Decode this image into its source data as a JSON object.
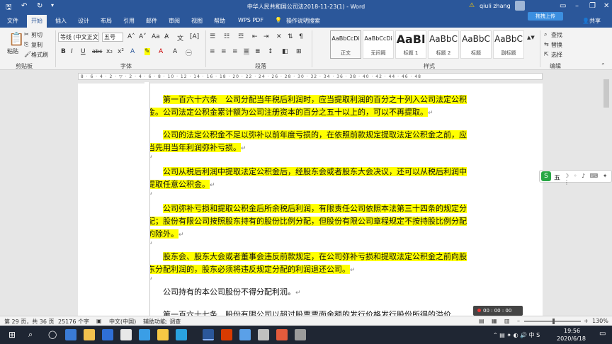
{
  "titlebar": {
    "title": "中华人民共和国公司法2018-11-23(1)  -  Word",
    "user": "qiuli zhang",
    "upload_button": "拖拽上传",
    "save_icon": "save-icon",
    "undo_icon": "undo-icon",
    "redo_icon": "redo-icon"
  },
  "tabs": [
    "文件",
    "开始",
    "插入",
    "设计",
    "布局",
    "引用",
    "邮件",
    "审阅",
    "视图",
    "帮助",
    "WPS PDF"
  ],
  "tell_me": "操作说明搜索",
  "share": "共享",
  "ribbon": {
    "clipboard": {
      "paste": "粘贴",
      "cut": "剪切",
      "copy": "复制",
      "format_painter": "格式刷",
      "label": "剪贴板"
    },
    "font": {
      "font_name": "等线 (中文正文",
      "font_size": "五号",
      "bold": "B",
      "italic": "I",
      "underline": "U",
      "strike": "abc",
      "subscript": "x₂",
      "superscript": "x²",
      "label": "字体"
    },
    "paragraph": {
      "label": "段落"
    },
    "styles": {
      "items": [
        {
          "preview": "AaBbCcDi",
          "name": "正文"
        },
        {
          "preview": "AaBbCcDi",
          "name": "无间隔"
        },
        {
          "preview": "AaBl",
          "name": "标题 1"
        },
        {
          "preview": "AaBbC",
          "name": "标题 2"
        },
        {
          "preview": "AaBbC",
          "name": "标题"
        },
        {
          "preview": "AaBbC",
          "name": "副标题"
        }
      ],
      "label": "样式"
    },
    "editing": {
      "find": "查找",
      "replace": "替换",
      "select": "选择",
      "label": "编辑"
    }
  },
  "document": {
    "paragraphs": [
      {
        "text": "第一百六十六条　公司分配当年税后利润时，应当提取利润的百分之十列入公司法定公积金。公司法定公积金累计额为公司注册资本的百分之五十以上的，可以不再提取。",
        "highlighted": true
      },
      {
        "text": "公司的法定公积金不足以弥补以前年度亏损的，在依照前款规定提取法定公积金之前，应当先用当年利润弥补亏损。",
        "highlighted": true
      },
      {
        "text": "公司从税后利润中提取法定公积金后，经股东会或者股东大会决议，还可以从税后利润中提取任意公积金。",
        "highlighted": true
      },
      {
        "text": "公司弥补亏损和提取公积金后所余税后利润，有限责任公司依照本法第三十四条的规定分配；股份有限公司按照股东持有的股份比例分配，但股份有限公司章程规定不按持股比例分配的除外。",
        "highlighted": true
      },
      {
        "text": "股东会、股东大会或者董事会违反前款规定，在公司弥补亏损和提取法定公积金之前向股东分配利润的，股东必须将违反规定分配的利润退还公司。",
        "highlighted": true
      },
      {
        "text": "公司持有的本公司股份不得分配利润。",
        "highlighted": false
      },
      {
        "text": "第一百六十七条　股份有限公司以超过股票票面金额的发行价格发行股份所得的溢价",
        "highlighted": false
      }
    ],
    "paragraph_mark": "↵"
  },
  "float_toolbar": {
    "logo": "S",
    "text": "五"
  },
  "recording": "00 : 00 : 00",
  "statusbar": {
    "page": "第 29 页，共 36 页",
    "words": "25176 个字",
    "language": "中文(中国)",
    "accessibility": "辅助功能: 调查",
    "zoom": "130%"
  },
  "taskbar": {
    "time": "19:56",
    "date": "2020/6/18"
  },
  "colors": {
    "word_blue": "#2b579a",
    "highlight": "#ffff00"
  }
}
